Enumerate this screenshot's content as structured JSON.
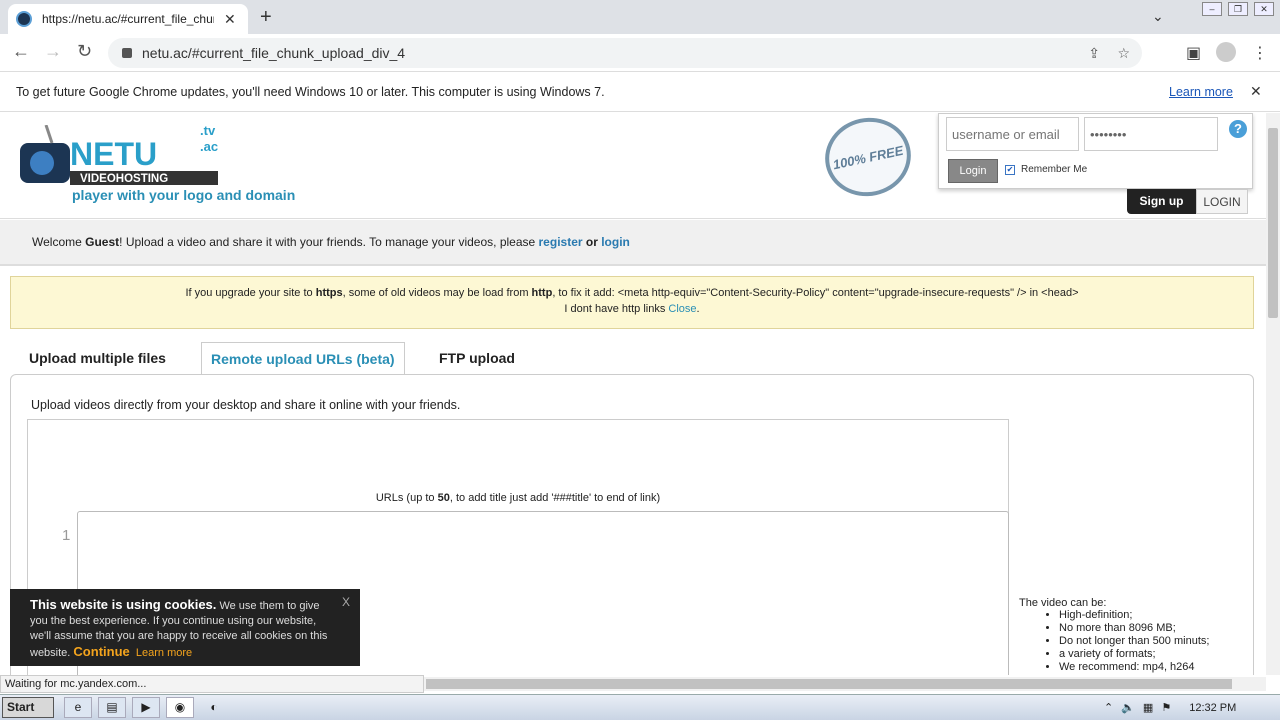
{
  "browser": {
    "tab_title": "https://netu.ac/#current_file_chunk",
    "new_tab": "+",
    "address": "netu.ac/#current_file_chunk_upload_div_4",
    "infobar_text": "To get future Google Chrome updates, you'll need Windows 10 or later. This computer is using Windows 7.",
    "infobar_link": "Learn more",
    "status": "Waiting for mc.yandex.com..."
  },
  "header": {
    "logo_main": "NETU",
    "logo_sub": "VIDEOHOSTING",
    "tld_tv": ".tv",
    "tld_ac": ".ac",
    "tagline": "player with your logo and domain",
    "seal_text": "100% FREE",
    "username_placeholder": "username or email",
    "password_mask": "••••••••",
    "login_button": "Login",
    "remember_label": "Remember Me",
    "help_icon": "?",
    "signup_button": "Sign up",
    "login_link": "LOGIN"
  },
  "welcome": {
    "prefix": "Welcome ",
    "guest": "Guest",
    "middle": "! Upload a video and share it with your friends. To manage your videos, please ",
    "register": "register",
    "or": " or ",
    "login": "login"
  },
  "notice": {
    "p1": "If you upgrade your site to ",
    "https": "https",
    "p2": ", some of old videos may be load from ",
    "http": "http",
    "p3": ", to fix it add: <meta http-equiv=\"Content-Security-Policy\" content=\"upgrade-insecure-requests\" /> in <head>",
    "line2": "I dont have http links ",
    "close": "Close",
    "dot": "."
  },
  "upload": {
    "tabs": [
      "Upload multiple files",
      "Remote upload URLs (beta)",
      "FTP upload"
    ],
    "intro": "Upload videos directly from your desktop and share it online with your friends.",
    "urls_caption_a": "URLs (up to ",
    "urls_max": "50",
    "urls_caption_b": ", to add title just add '###title' to end of link)",
    "line_number": "1",
    "specs_title": "The video can be:",
    "specs": [
      "High-definition;",
      "No more than 8096 MB;",
      "Do not longer than 500 minuts;",
      "a variety of formats;",
      "We recommend: mp4, h264"
    ]
  },
  "cookie": {
    "title": "This website is using cookies.",
    "body": " We use them to give you the best experience. If you continue using our website, we'll assume that you are happy to receive all cookies on this website. ",
    "continue": "Continue",
    "learn": "Learn more",
    "close": "X"
  },
  "taskbar": {
    "start": "Start",
    "clock": "12:32 PM"
  }
}
